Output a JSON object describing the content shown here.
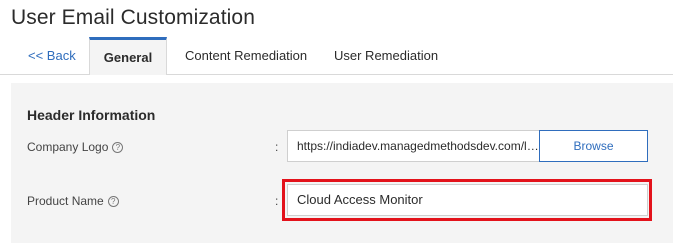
{
  "page": {
    "title": "User Email Customization"
  },
  "tabs": {
    "back": "<< Back",
    "items": [
      "General",
      "Content Remediation",
      "User Remediation"
    ],
    "active": "General"
  },
  "header_section": {
    "heading": "Header Information",
    "company_logo": {
      "label": "Company Logo",
      "value": "https://indiadev.managedmethodsdev.com/logo.png",
      "browse_label": "Browse"
    },
    "product_name": {
      "label": "Product Name",
      "value": "Cloud Access Monitor"
    },
    "colon": ":"
  },
  "icons": {
    "help": "help-circle-icon"
  },
  "colors": {
    "accent": "#2f6dbd",
    "highlight": "#e3121b",
    "panel": "#f4f4f4"
  }
}
